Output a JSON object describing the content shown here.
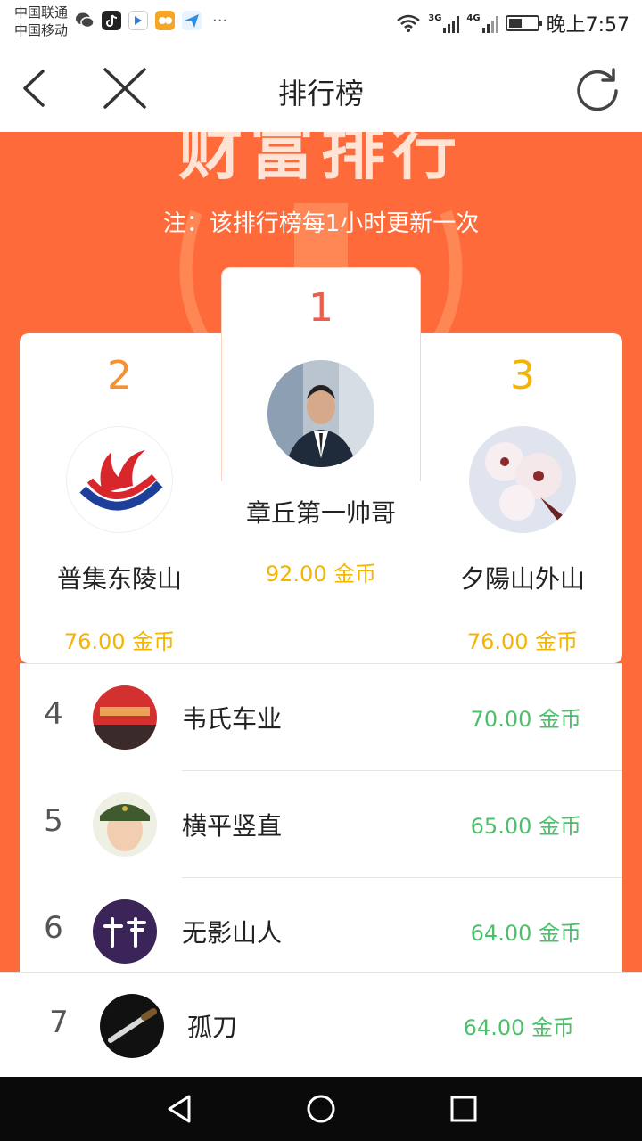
{
  "status_bar": {
    "carrier_1": "中国联通",
    "carrier_2": "中国移动",
    "network_1": "3G",
    "network_2": "4G",
    "time": "晚上7:57"
  },
  "nav": {
    "title": "排行榜"
  },
  "banner": {
    "heading": "财富排行",
    "notice": "注：该排行榜每1小时更新一次"
  },
  "colors": {
    "banner": "#ff6a3a",
    "rank_1": "#ef5b4c",
    "rank_2": "#f5922b",
    "rank_3": "#f5b400",
    "top_coins": "#f4b400",
    "list_coins": "#4cbf6a"
  },
  "podium": [
    {
      "rank": "1",
      "name": "章丘第一帅哥",
      "coins": "92.00 金币",
      "avatar": "man-in-suit-avatar"
    },
    {
      "rank": "2",
      "name": "普集东陵山",
      "coins": "76.00 金币",
      "avatar": "red-blue-logo-avatar"
    },
    {
      "rank": "3",
      "name": "夕陽山外山",
      "coins": "76.00 金币",
      "avatar": "blossom-avatar"
    }
  ],
  "list": [
    {
      "rank": "4",
      "name": "韦氏车业",
      "coins": "70.00 金币",
      "avatar": "shop-banner-avatar"
    },
    {
      "rank": "5",
      "name": "横平竖直",
      "coins": "65.00 金币",
      "avatar": "woman-in-cap-avatar"
    },
    {
      "rank": "6",
      "name": "无影山人",
      "coins": "64.00 金币",
      "avatar": "calligraphy-avatar"
    }
  ],
  "pinned": {
    "rank": "7",
    "name": "孤刀",
    "coins": "64.00 金币",
    "avatar": "blade-avatar"
  }
}
